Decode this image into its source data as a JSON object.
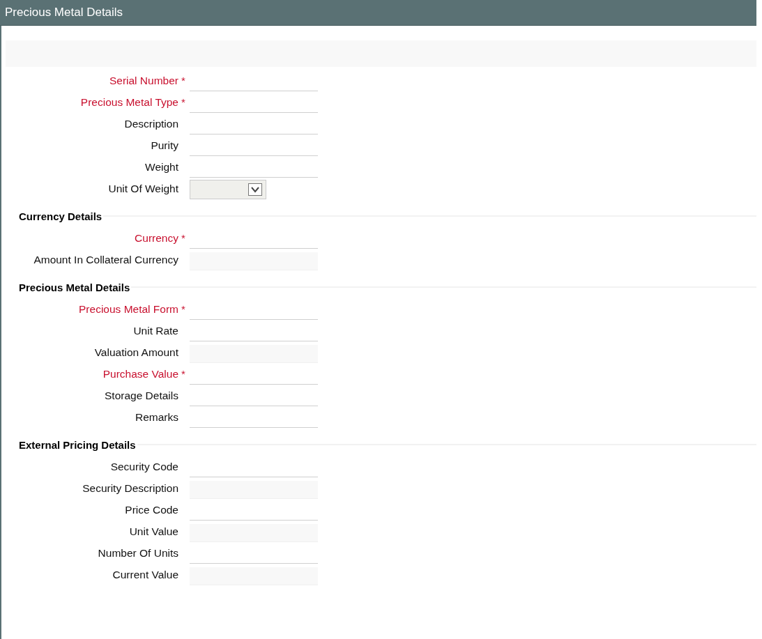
{
  "window": {
    "title": "Precious Metal Details"
  },
  "sections": [
    {
      "fields": [
        {
          "label": "Serial Number",
          "required": true,
          "marker": "*",
          "kind": "text"
        },
        {
          "label": "Precious Metal Type",
          "required": true,
          "marker": "*",
          "kind": "text"
        },
        {
          "label": "Description",
          "required": false,
          "kind": "text"
        },
        {
          "label": "Purity",
          "required": false,
          "kind": "text"
        },
        {
          "label": "Weight",
          "required": false,
          "kind": "text"
        },
        {
          "label": "Unit Of Weight",
          "required": false,
          "kind": "select"
        }
      ]
    },
    {
      "heading": "Currency Details",
      "fields": [
        {
          "label": "Currency",
          "required": true,
          "marker": "*",
          "kind": "text"
        },
        {
          "label": "Amount In Collateral Currency",
          "required": false,
          "kind": "readonly"
        }
      ]
    },
    {
      "heading": "Precious Metal Details",
      "fields": [
        {
          "label": "Precious Metal Form",
          "required": true,
          "marker": "*",
          "kind": "text"
        },
        {
          "label": "Unit Rate",
          "required": false,
          "kind": "text"
        },
        {
          "label": "Valuation Amount",
          "required": false,
          "kind": "readonly"
        },
        {
          "label": "Purchase Value",
          "required": true,
          "marker": "*",
          "kind": "text"
        },
        {
          "label": "Storage Details",
          "required": false,
          "kind": "text"
        },
        {
          "label": "Remarks",
          "required": false,
          "kind": "text"
        }
      ]
    },
    {
      "heading": "External Pricing Details",
      "fields": [
        {
          "label": "Security Code",
          "required": false,
          "kind": "text"
        },
        {
          "label": "Security Description",
          "required": false,
          "kind": "readonly"
        },
        {
          "label": "Price Code",
          "required": false,
          "kind": "text"
        },
        {
          "label": "Unit Value",
          "required": false,
          "kind": "readonly"
        },
        {
          "label": "Number Of Units",
          "required": false,
          "kind": "text"
        },
        {
          "label": "Current Value",
          "required": false,
          "kind": "readonly"
        }
      ]
    }
  ]
}
